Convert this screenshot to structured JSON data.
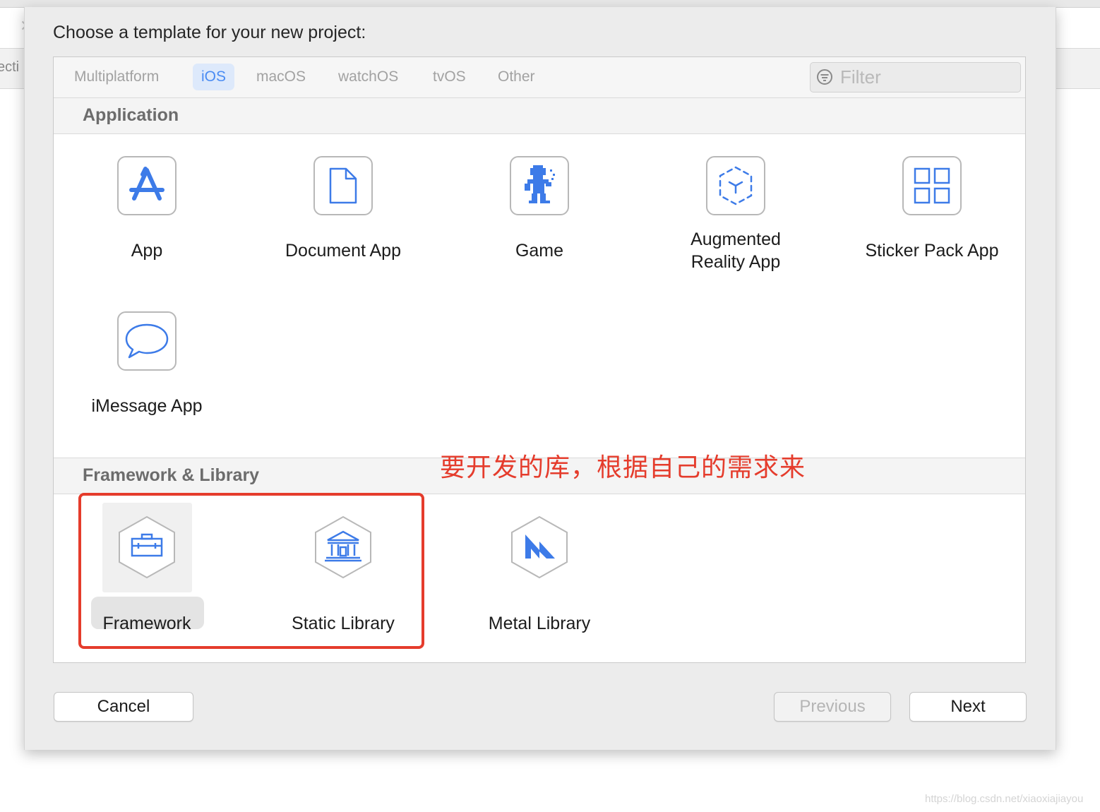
{
  "background": {
    "partial_text": "ecti"
  },
  "dialog": {
    "title": "Choose a template for your new project:",
    "platform_tabs": [
      {
        "label": "Multiplatform",
        "active": false
      },
      {
        "label": "iOS",
        "active": true
      },
      {
        "label": "macOS",
        "active": false
      },
      {
        "label": "watchOS",
        "active": false
      },
      {
        "label": "tvOS",
        "active": false
      },
      {
        "label": "Other",
        "active": false
      }
    ],
    "filter": {
      "placeholder": "Filter",
      "value": ""
    },
    "sections": [
      {
        "title": "Application",
        "templates": [
          {
            "label": "App",
            "icon": "app-store-icon"
          },
          {
            "label": "Document App",
            "icon": "document-icon"
          },
          {
            "label": "Game",
            "icon": "game-sprite-icon"
          },
          {
            "label": "Augmented\nReality App",
            "icon": "ar-cube-icon"
          },
          {
            "label": "Sticker Pack App",
            "icon": "grid-icon"
          },
          {
            "label": "iMessage App",
            "icon": "speech-bubble-icon"
          }
        ]
      },
      {
        "title": "Framework & Library",
        "templates": [
          {
            "label": "Framework",
            "icon": "toolbox-icon",
            "selected": true
          },
          {
            "label": "Static Library",
            "icon": "library-building-icon"
          },
          {
            "label": "Metal Library",
            "icon": "metal-icon"
          }
        ]
      }
    ],
    "buttons": {
      "cancel": "Cancel",
      "previous": "Previous",
      "next": "Next"
    }
  },
  "annotation": {
    "text": "要开发的库，根据自己的需求来",
    "color": "#e53c2c"
  },
  "watermark": "https://blog.csdn.net/xiaoxiajiayou",
  "colors": {
    "accent": "#4a8cf3",
    "icon_blue": "#3d7be8"
  }
}
